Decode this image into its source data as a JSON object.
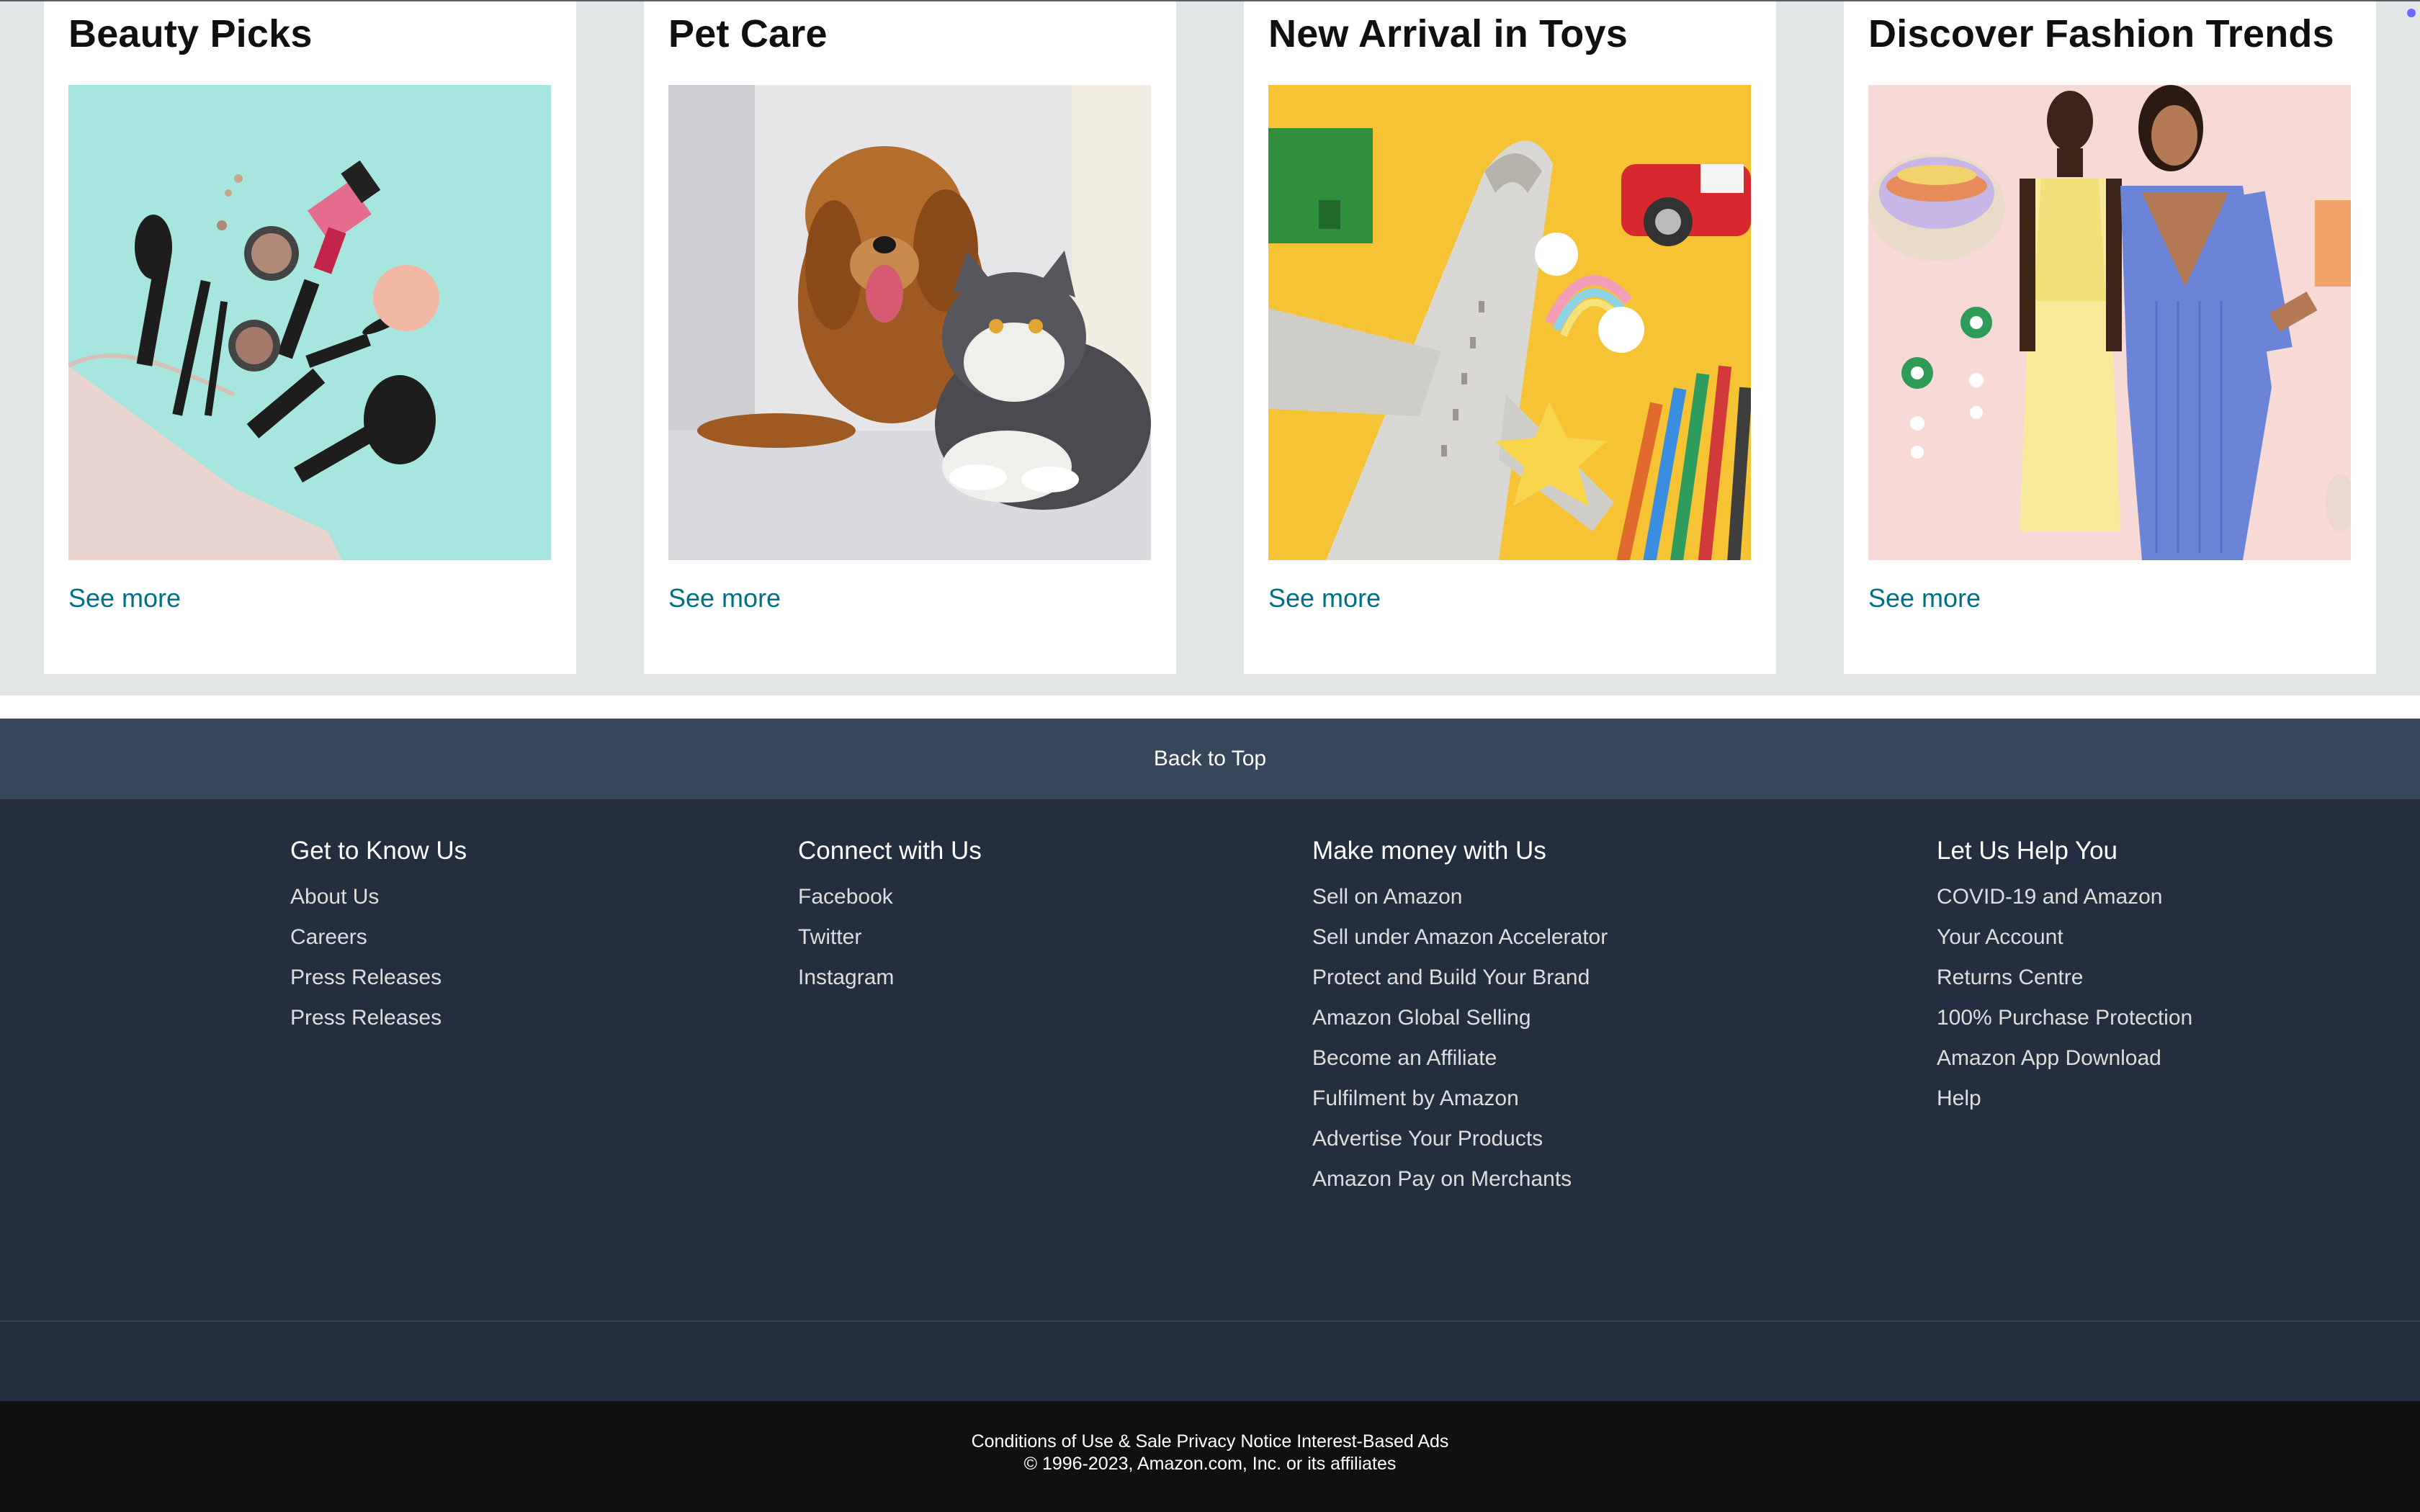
{
  "cards": [
    {
      "title": "Beauty Picks",
      "link": "See more",
      "image": "makeup-products-image"
    },
    {
      "title": "Pet Care",
      "link": "See more",
      "image": "dog-and-cat-image"
    },
    {
      "title": "New Arrival in Toys",
      "link": "See more",
      "image": "toy-plane-and-pencils-image"
    },
    {
      "title": "Discover Fashion Trends",
      "link": "See more",
      "image": "fashion-models-image"
    }
  ],
  "back_to_top": "Back to Top",
  "footer": {
    "columns": [
      {
        "title": "Get to Know Us",
        "links": [
          "About Us",
          "Careers",
          "Press Releases",
          "Press Releases"
        ]
      },
      {
        "title": "Connect with Us",
        "links": [
          "Facebook",
          "Twitter",
          "Instagram"
        ]
      },
      {
        "title": "Make money with Us",
        "links": [
          "Sell on Amazon",
          "Sell under Amazon Accelerator",
          "Protect and Build Your Brand",
          "Amazon Global Selling",
          "Become an Affiliate",
          "Fulfilment by Amazon",
          "Advertise Your Products",
          "Amazon Pay on Merchants"
        ]
      },
      {
        "title": "Let Us Help You",
        "links": [
          "COVID-19 and Amazon",
          "Your Account",
          "Returns Centre",
          "100% Purchase Protection",
          "Amazon App Download",
          "Help"
        ]
      }
    ],
    "bottom_links": [
      "Conditions of Use & Sale",
      "Privacy Notice",
      "Interest-Based Ads"
    ],
    "copyright": "© 1996-2023, Amazon.com, Inc. or its affiliates"
  },
  "colors": {
    "link": "#007185",
    "back_to_top_bg": "#37475a",
    "footer_bg": "#232f3e",
    "footer_bottom_bg": "#0f1111",
    "page_bg": "#e3e6e6"
  }
}
